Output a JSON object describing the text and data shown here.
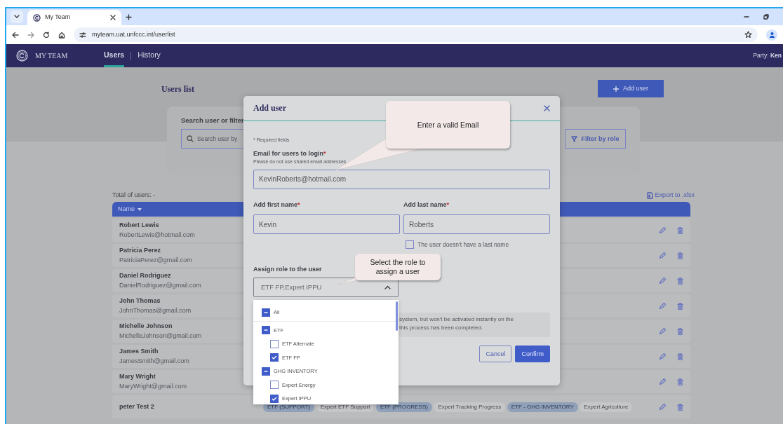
{
  "browser": {
    "tabs": [
      {
        "title": "My Team",
        "selected": true
      }
    ],
    "url": "myteam.uat.unfccc.int/userlist"
  },
  "app": {
    "brand": "MY TEAM",
    "nav": [
      {
        "label": "Users",
        "selected": true
      },
      {
        "label": "History",
        "selected": false
      }
    ],
    "party": "Party: **Ken**"
  },
  "page": {
    "title": "Users list",
    "add_button": "Add user",
    "search": {
      "title": "Search user or filter",
      "placeholder": "Search user by",
      "filter_button": "Filter by role"
    },
    "total": "Total of users: -",
    "export": "Export to .xlsx",
    "table": {
      "columns": [
        "Name"
      ],
      "rows": [
        {
          "name": "Robert Lewis",
          "email": "RobertLewis@hotmail.com",
          "tags": []
        },
        {
          "name": "Patricia Perez",
          "email": "PatriciaPerez@gmail.com",
          "tags": []
        },
        {
          "name": "Daniel Rodriguez",
          "email": "DanielRodriguez@gmail.com",
          "tags": []
        },
        {
          "name": "John Thomas",
          "email": "JohnThomas@gmail.com",
          "tags": []
        },
        {
          "name": "Michelle Johnson",
          "email": "MichelleJohnson@gmail.com",
          "tags": []
        },
        {
          "name": "James Smith",
          "email": "JamesSmith@gmail.com",
          "tags": []
        },
        {
          "name": "Mary Wright",
          "email": "MaryWright@gmail.com",
          "tags": []
        },
        {
          "name": "peter Test 2",
          "email": "",
          "tags": [
            {
              "kind": "group",
              "text": "ETF (SUPPORT)"
            },
            {
              "kind": "role",
              "text": "Expert ETF Support"
            },
            {
              "kind": "group",
              "text": "ETF (PROGRESS)"
            },
            {
              "kind": "role",
              "text": "Expert Tracking Progress"
            },
            {
              "kind": "group",
              "text": "ETF - GHG INVENTORY"
            },
            {
              "kind": "role",
              "text": "Expert Agriculture"
            }
          ]
        }
      ]
    }
  },
  "modal": {
    "title": "Add user",
    "required_note": "* Required fields",
    "required_mark": "*",
    "email_label": "Email for users to login",
    "email_hint": "Please do not use shared email addresses",
    "email_value": "KevinRoberts@hotmail.com",
    "first_label": "Add first name",
    "first_value": "Kevin",
    "last_label": "Add last name",
    "last_value": "Roberts",
    "no_last_name": {
      "label": "The user doesn't have a last name",
      "checked": false
    },
    "role_label": "Assign role to the user",
    "role_value": "ETF FP,Expert IPPU",
    "expanded": true,
    "info_lines": [
      "system, but won't be activated instantly on the",
      "this process has been completed."
    ],
    "cancel": "Cancel",
    "confirm": "Confirm"
  },
  "role_dropdown": {
    "all": {
      "label": "All",
      "indeterminate": true
    },
    "groups": [
      {
        "label": "ETF",
        "indeterminate": true,
        "children": [
          {
            "label": "ETF Alternate",
            "checked": false
          },
          {
            "label": "ETF FP",
            "checked": true
          }
        ]
      },
      {
        "label": "GHG INVENTORY",
        "indeterminate": true,
        "children": [
          {
            "label": "Expert Energy",
            "checked": false
          },
          {
            "label": "Expert IPPU",
            "checked": true
          }
        ]
      }
    ]
  },
  "callouts": [
    {
      "text": "Enter a valid Email"
    },
    {
      "text": "Select the role to assign a user"
    }
  ]
}
